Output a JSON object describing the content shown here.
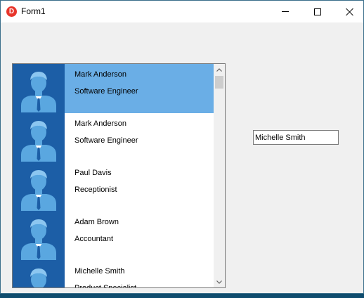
{
  "window": {
    "title": "Form1",
    "icon_letter": "D",
    "controls": {
      "minimize": "minimize-icon",
      "maximize": "maximize-icon",
      "close": "close-icon"
    }
  },
  "list": {
    "selected_index": 0,
    "items": [
      {
        "name": "Mark Anderson",
        "role": "Software Engineer",
        "avatar": "person-avatar-icon"
      },
      {
        "name": "Mark Anderson",
        "role": "Software Engineer",
        "avatar": "person-avatar-icon"
      },
      {
        "name": "Paul Davis",
        "role": "Receptionist",
        "avatar": "person-avatar-icon"
      },
      {
        "name": "Adam Brown",
        "role": "Accountant",
        "avatar": "person-avatar-icon"
      },
      {
        "name": "Michelle Smith",
        "role": "Product Specialist",
        "avatar": "person-avatar-icon"
      }
    ]
  },
  "scrollbar": {
    "up_arrow": "^",
    "down_arrow": "v"
  },
  "textbox": {
    "value": "Michelle Smith"
  },
  "colors": {
    "selection": "#6aaee6",
    "avatar_bg": "#1c5ea6",
    "avatar_figure": "#5aa7e0",
    "app_icon": "#e8352b"
  }
}
